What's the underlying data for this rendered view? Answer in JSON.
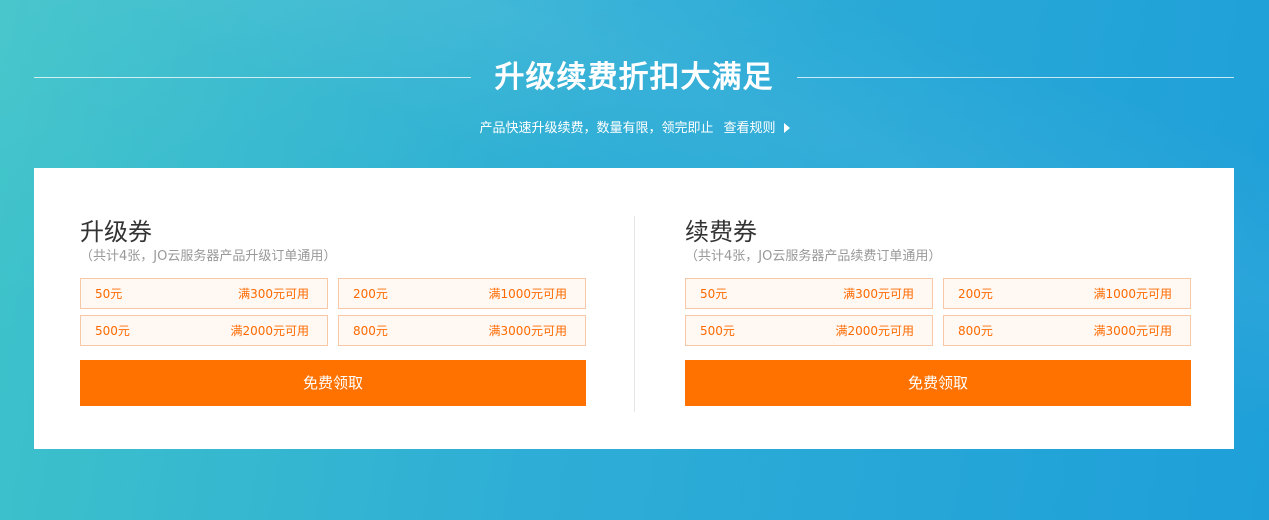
{
  "header": {
    "title": "升级续费折扣大满足",
    "subtitle": "产品快速升级续费，数量有限，领完即止",
    "rules_link": "查看规则"
  },
  "sections": [
    {
      "title": "升级券",
      "desc": "（共计4张，JO云服务器产品升级订单通用）",
      "coupons": [
        {
          "amount": "50元",
          "condition": "满300元可用"
        },
        {
          "amount": "200元",
          "condition": "满1000元可用"
        },
        {
          "amount": "500元",
          "condition": "满2000元可用"
        },
        {
          "amount": "800元",
          "condition": "满3000元可用"
        }
      ],
      "button": "免费领取"
    },
    {
      "title": "续费券",
      "desc": "（共计4张，JO云服务器产品续费订单通用）",
      "coupons": [
        {
          "amount": "50元",
          "condition": "满300元可用"
        },
        {
          "amount": "200元",
          "condition": "满1000元可用"
        },
        {
          "amount": "500元",
          "condition": "满2000元可用"
        },
        {
          "amount": "800元",
          "condition": "满3000元可用"
        }
      ],
      "button": "免费领取"
    }
  ],
  "colors": {
    "accent": "#ff7200",
    "coupon_text": "#ff6a00",
    "coupon_border": "#f8c7a6",
    "coupon_bg": "#fff8f3",
    "background_start": "#3ec3c9",
    "background_end": "#1e9fd8"
  },
  "icons": {
    "rules_arrow": "triangle-right-icon"
  }
}
